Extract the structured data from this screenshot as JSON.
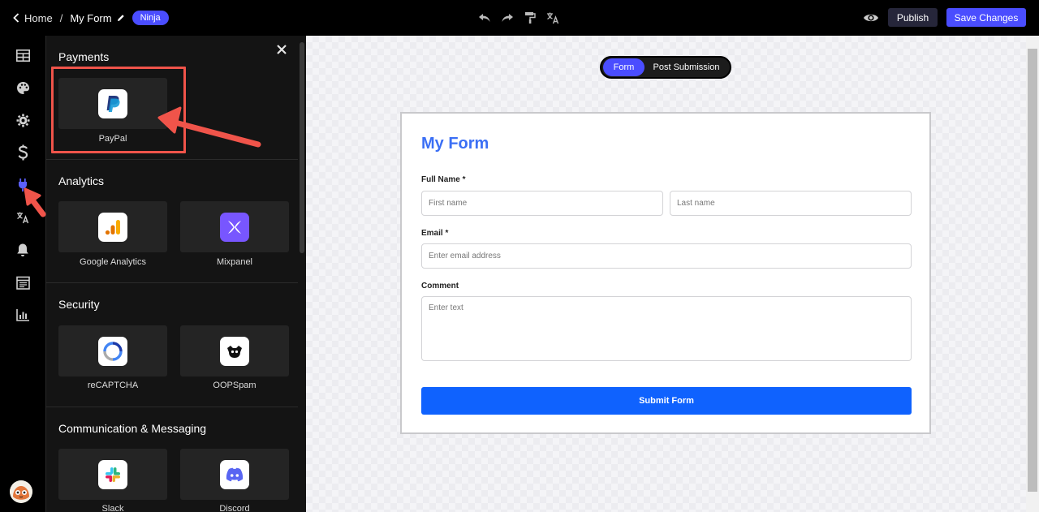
{
  "header": {
    "home_label": "Home",
    "separator": "/",
    "form_name": "My Form",
    "badge": "Ninja",
    "publish_label": "Publish",
    "save_label": "Save Changes",
    "tools": [
      "undo-icon",
      "redo-icon",
      "paint-roller-icon",
      "translate-icon"
    ]
  },
  "rail": {
    "items": [
      "layout-grid-icon",
      "palette-icon",
      "gear-icon",
      "dollar-icon",
      "plug-icon",
      "translate-icon",
      "bell-icon",
      "calendar-icon",
      "bar-chart-icon"
    ],
    "active": "plug-icon"
  },
  "panel": {
    "sections": [
      {
        "title": "Payments",
        "items": [
          {
            "label": "PayPal",
            "icon": "paypal-icon"
          }
        ]
      },
      {
        "title": "Analytics",
        "items": [
          {
            "label": "Google Analytics",
            "icon": "google-analytics-icon"
          },
          {
            "label": "Mixpanel",
            "icon": "mixpanel-icon"
          }
        ]
      },
      {
        "title": "Security",
        "items": [
          {
            "label": "reCAPTCHA",
            "icon": "recaptcha-icon"
          },
          {
            "label": "OOPSpam",
            "icon": "oopspam-icon"
          }
        ]
      },
      {
        "title": "Communication & Messaging",
        "items": [
          {
            "label": "Slack",
            "icon": "slack-icon"
          },
          {
            "label": "Discord",
            "icon": "discord-icon"
          }
        ]
      }
    ]
  },
  "canvas": {
    "toggle": {
      "form_label": "Form",
      "post_label": "Post Submission",
      "active": "Form"
    },
    "form": {
      "title": "My Form",
      "full_name_label": "Full Name *",
      "first_name_placeholder": "First name",
      "last_name_placeholder": "Last name",
      "email_label": "Email *",
      "email_placeholder": "Enter email address",
      "comment_label": "Comment",
      "comment_placeholder": "Enter text",
      "submit_label": "Submit Form"
    }
  },
  "colors": {
    "accent": "#4a4dff",
    "submit": "#0f62fe",
    "title": "#3b6ff5",
    "annotation": "#f0544a"
  }
}
